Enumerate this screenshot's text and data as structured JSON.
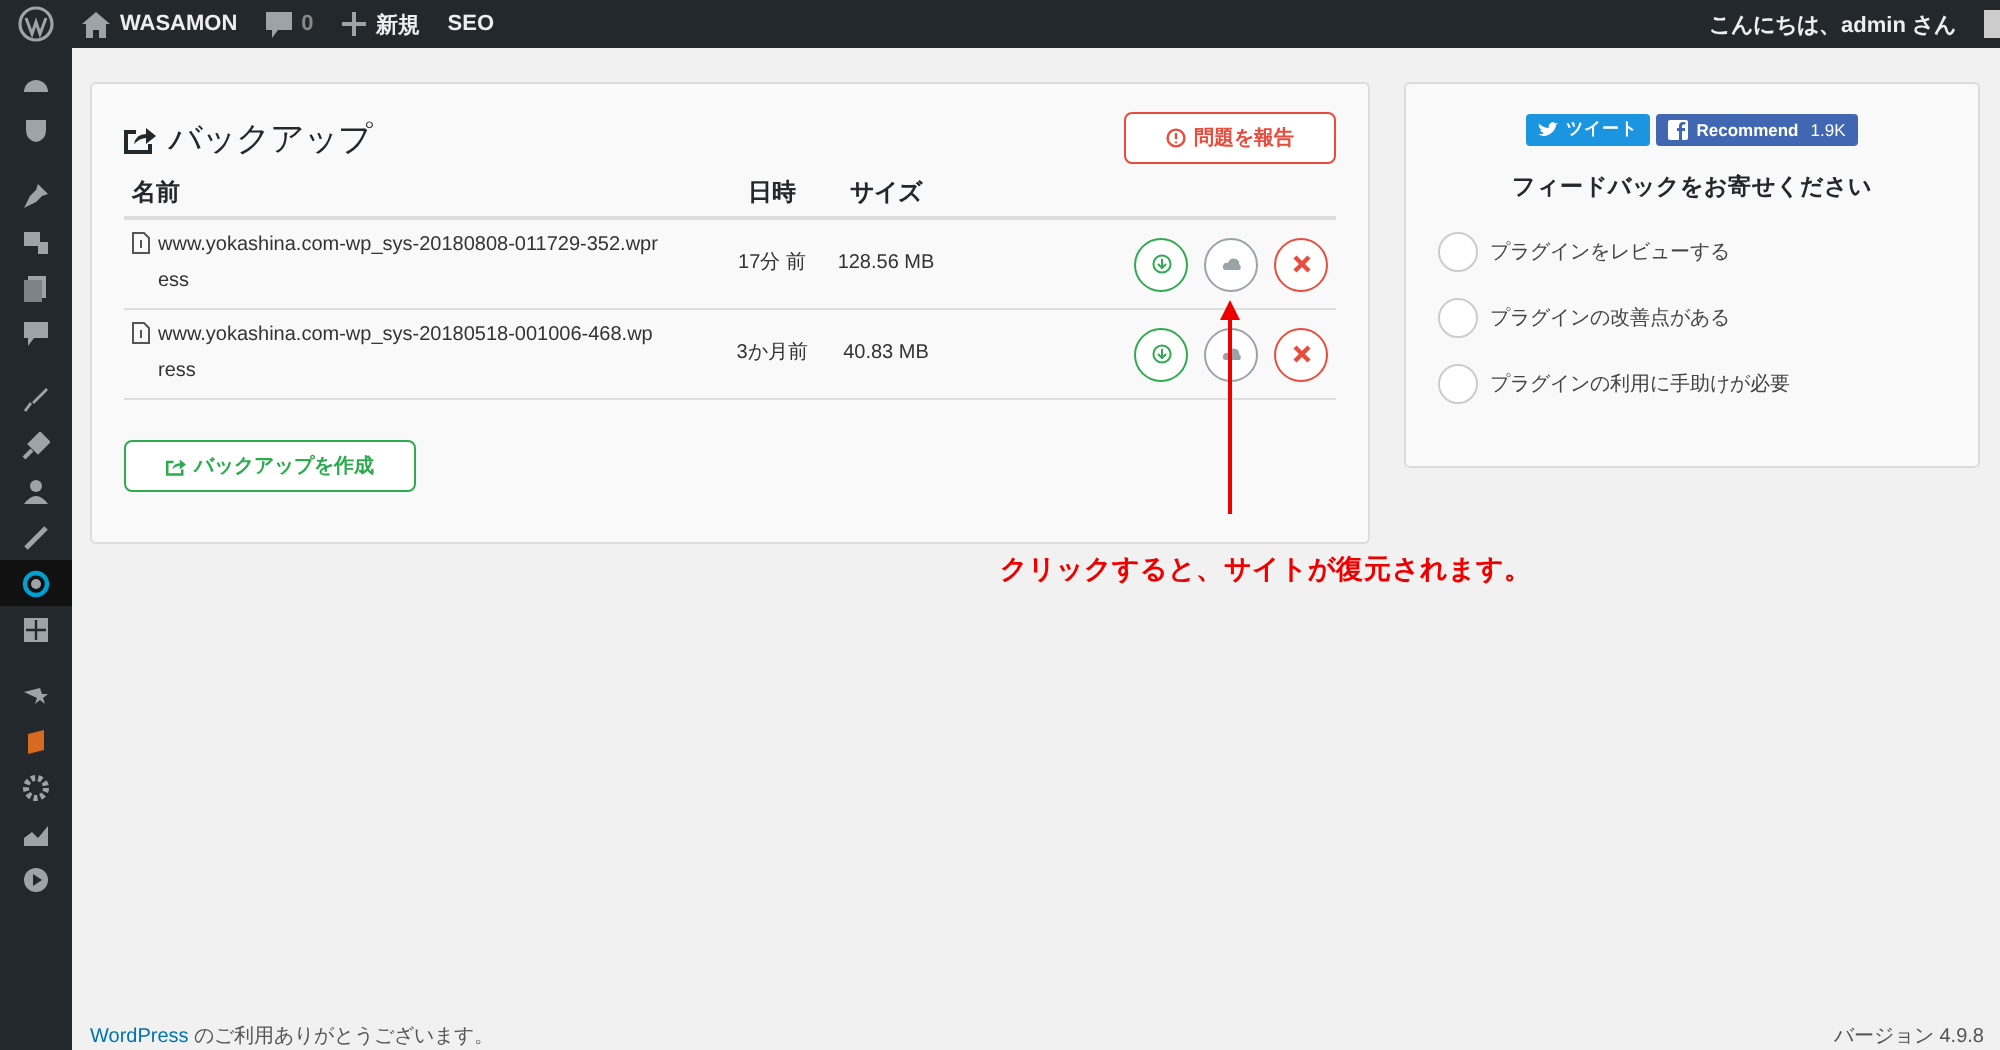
{
  "admin_bar": {
    "site": "WASAMON",
    "comments": "0",
    "new": "新規",
    "seo": "SEO",
    "greeting": "こんにちは、admin さん"
  },
  "sidebar": {
    "items": [
      {
        "selected": false
      },
      {
        "selected": false
      },
      {
        "selected": false
      },
      {
        "selected": false
      },
      {
        "selected": false
      },
      {
        "selected": false
      },
      {
        "selected": false
      },
      {
        "selected": false
      },
      {
        "selected": false
      },
      {
        "selected": false
      },
      {
        "selected": true
      },
      {
        "selected": false
      },
      {
        "selected": false
      },
      {
        "selected": false
      },
      {
        "selected": false
      },
      {
        "selected": false
      },
      {
        "selected": false
      }
    ]
  },
  "backup": {
    "title": "バックアップ",
    "report_button": "問題を報告",
    "table": {
      "columns": [
        "名前",
        "日時",
        "サイズ"
      ],
      "rows": [
        {
          "name": "www.yokashina.com-wp_sys-20180808-011729-352.wpress",
          "date": "17分 前",
          "size": "128.56 MB"
        },
        {
          "name": "www.yokashina.com-wp_sys-20180518-001006-468.wpress",
          "date": "3か月前",
          "size": "40.83 MB"
        }
      ]
    },
    "create_button": "バックアップを作成"
  },
  "feedback": {
    "tweet": "ツイート",
    "recommend": "Recommend",
    "recommend_count": "1.9K",
    "title": "フィードバックをお寄せください",
    "options": [
      {
        "label": "プラグインをレビューする",
        "selected": false
      },
      {
        "label": "プラグインの改善点がある",
        "selected": false
      },
      {
        "label": "プラグインの利用に手助けが必要",
        "selected": false
      }
    ]
  },
  "annotation": "クリックすると、サイトが復元されます。",
  "footer": {
    "link": "WordPress",
    "text": "のご利用ありがとうございます。",
    "version": "バージョン 4.9.8"
  }
}
